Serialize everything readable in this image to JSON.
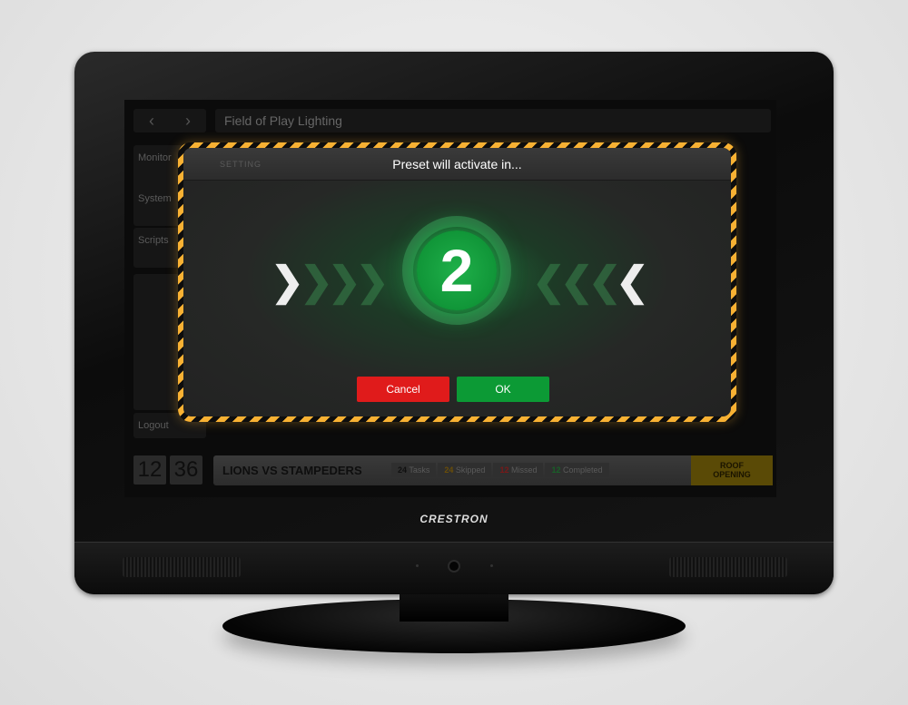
{
  "brand": "CRESTRON",
  "app": {
    "nav_back": "‹",
    "nav_forward": "›",
    "title": "Field of Play Lighting",
    "ghost_label": "SETTING",
    "sidebar": [
      "Monitor",
      "System",
      "Scripts"
    ],
    "logout": "Logout"
  },
  "clock": {
    "hours": "12",
    "minutes": "36"
  },
  "status_bar": {
    "event": "LIONS VS STAMPEDERS",
    "stats": [
      {
        "count": "24",
        "label": "Tasks",
        "color": "#1a1a1a"
      },
      {
        "count": "24",
        "label": "Skipped",
        "color": "#5a4200"
      },
      {
        "count": "12",
        "label": "Missed",
        "color": "#5a1010"
      },
      {
        "count": "12",
        "label": "Completed",
        "color": "#0f4a1c"
      }
    ],
    "action_line1": "ROOF",
    "action_line2": "OPENING"
  },
  "modal": {
    "title": "Preset will activate in...",
    "countdown": "2",
    "cancel": "Cancel",
    "ok": "OK",
    "colors": {
      "cancel": "#e01b1b",
      "ok": "#0c9a35",
      "stripe": "#f8b133"
    }
  }
}
